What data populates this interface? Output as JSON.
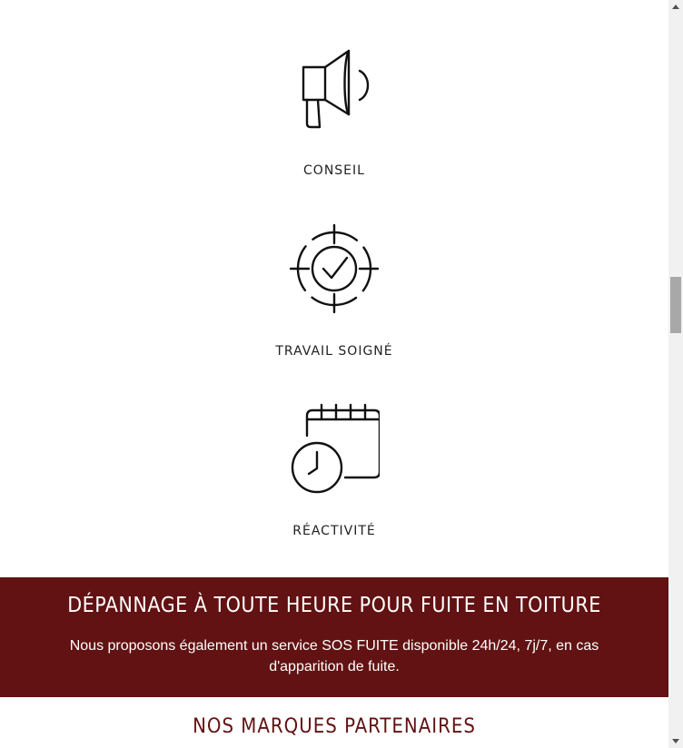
{
  "features": [
    {
      "icon": "megaphone-icon",
      "label": "CONSEIL"
    },
    {
      "icon": "target-check-icon",
      "label": "TRAVAIL SOIGNÉ"
    },
    {
      "icon": "calendar-clock-icon",
      "label": "RÉACTIVITÉ"
    }
  ],
  "banner": {
    "title": "DÉPANNAGE À TOUTE HEURE POUR FUITE EN TOITURE",
    "text": "Nous proposons également un service SOS FUITE disponible 24h/24, 7j/7, en cas d'apparition de fuite."
  },
  "partners": {
    "title": "NOS MARQUES PARTENAIRES"
  },
  "colors": {
    "banner_bg": "#621212",
    "accent": "#621212",
    "scrollbar_thumb": "#a8a8a8"
  }
}
